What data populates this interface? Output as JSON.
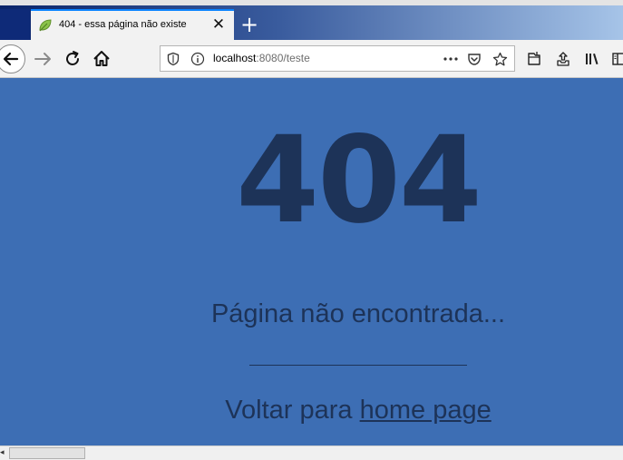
{
  "browser": {
    "tab": {
      "title": "404 - essa página não existe",
      "close_glyph": "✕",
      "favicon": "leaf-icon"
    },
    "new_tab_glyph": "+",
    "url": {
      "host": "localhost",
      "rest": ":8080/teste"
    },
    "toolbar_icons": [
      "page-actions-icon",
      "pocket-icon",
      "bookmark-star-icon",
      "downloads-icon",
      "extension-icon",
      "library-icon",
      "sidebar-icon"
    ],
    "colors": {
      "tab_accent": "#0a84ff",
      "tabbar_start": "#0a246a",
      "tabbar_end": "#a6c4e8"
    }
  },
  "page": {
    "code": "404",
    "message": "Página não encontrada...",
    "back_prefix": "Voltar para ",
    "home_link": "home page",
    "colors": {
      "background": "#3d6eb4",
      "text": "#1d3358"
    }
  }
}
